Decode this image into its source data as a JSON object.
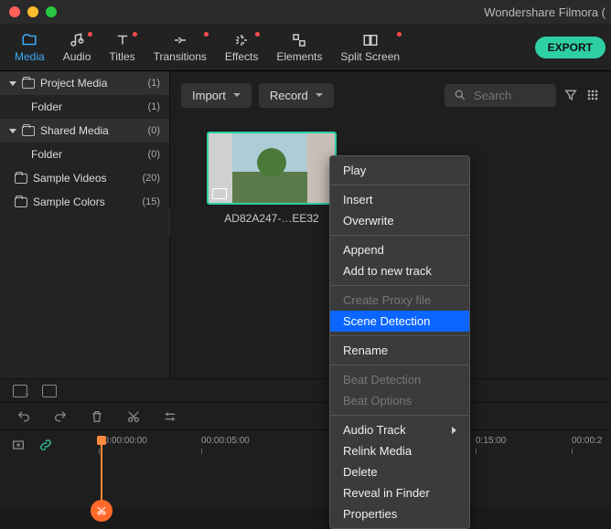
{
  "app_title": "Wondershare Filmora (",
  "tabs": {
    "media": "Media",
    "audio": "Audio",
    "titles": "Titles",
    "transitions": "Transitions",
    "effects": "Effects",
    "elements": "Elements",
    "split_screen": "Split Screen"
  },
  "export_label": "EXPORT",
  "sidebar": {
    "project_media": {
      "label": "Project Media",
      "count": "(1)"
    },
    "project_folder": {
      "label": "Folder",
      "count": "(1)"
    },
    "shared_media": {
      "label": "Shared Media",
      "count": "(0)"
    },
    "shared_folder": {
      "label": "Folder",
      "count": "(0)"
    },
    "sample_videos": {
      "label": "Sample Videos",
      "count": "(20)"
    },
    "sample_colors": {
      "label": "Sample Colors",
      "count": "(15)"
    }
  },
  "content_bar": {
    "import": "Import",
    "record": "Record",
    "search_placeholder": "Search"
  },
  "thumb_label": "AD82A247-…EE32",
  "timeline": {
    "t0": "00:00:00:00",
    "t1": "00:00:05:00",
    "t2": "0:15:00",
    "t3": "00:00:2"
  },
  "ctx": {
    "play": "Play",
    "insert": "Insert",
    "overwrite": "Overwrite",
    "append": "Append",
    "add_to_new_track": "Add to new track",
    "create_proxy": "Create Proxy file",
    "scene_detection": "Scene Detection",
    "rename": "Rename",
    "beat_detection": "Beat Detection",
    "beat_options": "Beat Options",
    "audio_track": "Audio Track",
    "relink_media": "Relink Media",
    "delete": "Delete",
    "reveal_in_finder": "Reveal in Finder",
    "properties": "Properties"
  }
}
